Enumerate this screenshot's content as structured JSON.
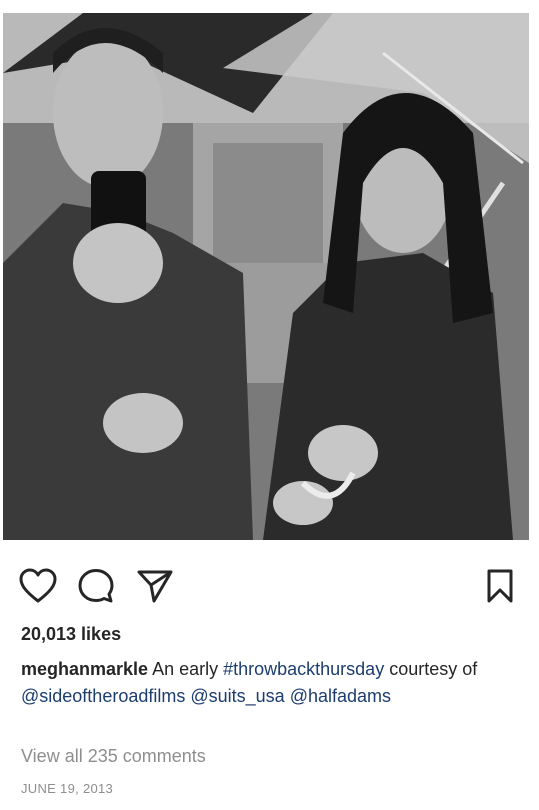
{
  "post": {
    "likes_text": "20,013 likes",
    "caption": {
      "username": "meghanmarkle",
      "text_1": " An early ",
      "hashtag": "#throwbackthursday",
      "text_2": " courtesy of ",
      "mention_1": "@sideoftheroadfilms",
      "space_1": " ",
      "mention_2": "@suits_usa",
      "space_2": " ",
      "mention_3": "@halfadams"
    },
    "view_comments": "View all 235 comments",
    "timestamp": "JUNE 19, 2013"
  },
  "icons": {
    "like": "heart-outline-icon",
    "comment": "speech-bubble-icon",
    "share": "paper-plane-icon",
    "save": "bookmark-icon"
  },
  "colors": {
    "text": "#262626",
    "link": "#1c3d6e",
    "muted": "#8e8e8e"
  }
}
